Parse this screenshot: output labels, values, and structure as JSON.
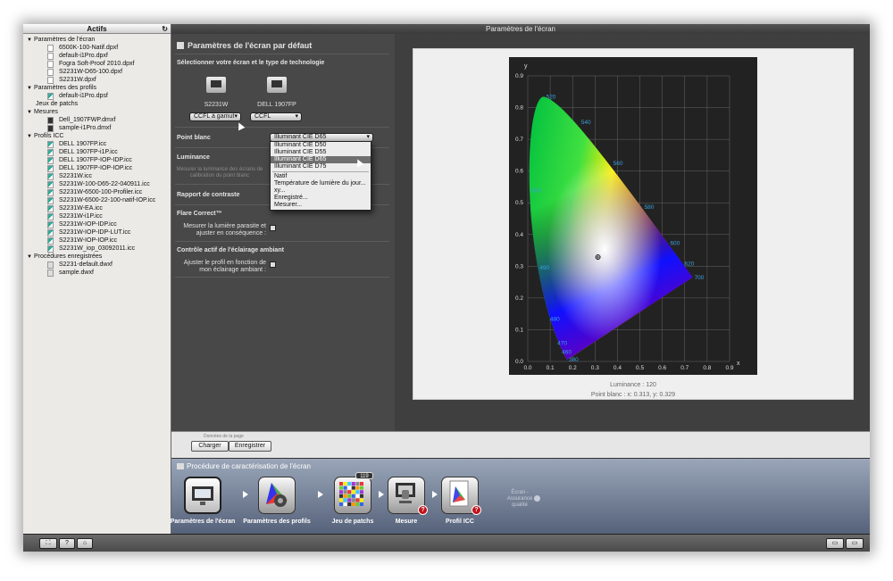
{
  "window_title": "Paramètres de l'écran",
  "sidebar": {
    "header": "Actifs",
    "refresh_icon": "refresh-icon",
    "tree": [
      {
        "type": "cat",
        "label": "Paramètres de l'écran"
      },
      {
        "type": "item",
        "label": "6500K-100-Natif.dpxf",
        "icon": "doc"
      },
      {
        "type": "item",
        "label": "default-i1Pro.dpxf",
        "icon": "doc"
      },
      {
        "type": "item",
        "label": "Fogra Soft-Proof 2010.dpxf",
        "icon": "doc"
      },
      {
        "type": "item",
        "label": "S2231W-D65-100.dpxf",
        "icon": "doc"
      },
      {
        "type": "item",
        "label": "S2231W.dpxf",
        "icon": "doc"
      },
      {
        "type": "cat",
        "label": "Paramètres des profils"
      },
      {
        "type": "item",
        "label": "default-i1Pro.dpsf",
        "icon": "icc"
      },
      {
        "type": "plain",
        "label": "Jeux de patchs"
      },
      {
        "type": "cat",
        "label": "Mesures"
      },
      {
        "type": "item",
        "label": "Dell_1907FWP.dmxf",
        "icon": "dm"
      },
      {
        "type": "item",
        "label": "sample-i1Pro.dmxf",
        "icon": "dm"
      },
      {
        "type": "cat",
        "label": "Profils ICC"
      },
      {
        "type": "item",
        "label": "DELL 1907FP.icc",
        "icon": "icc"
      },
      {
        "type": "item",
        "label": "DELL 1907FP-i1P.icc",
        "icon": "icc"
      },
      {
        "type": "item",
        "label": "DELL 1907FP-IOP-IDP.icc",
        "icon": "icc"
      },
      {
        "type": "item",
        "label": "DELL 1907FP-IOP-IOP.icc",
        "icon": "icc"
      },
      {
        "type": "item",
        "label": "S2231W.icc",
        "icon": "icc"
      },
      {
        "type": "item",
        "label": "S2231W-100-D65-22-040911.icc",
        "icon": "icc"
      },
      {
        "type": "item",
        "label": "S2231W-6500-100-Profiler.icc",
        "icon": "icc"
      },
      {
        "type": "item",
        "label": "S2231W-6500-22-100-natif-IOP.icc",
        "icon": "icc"
      },
      {
        "type": "item",
        "label": "S2231W-EA.icc",
        "icon": "icc"
      },
      {
        "type": "item",
        "label": "S2231W-i1P.icc",
        "icon": "icc"
      },
      {
        "type": "item",
        "label": "S2231W-IOP-IDP.icc",
        "icon": "icc"
      },
      {
        "type": "item",
        "label": "S2231W-IOP-IDP-LUT.icc",
        "icon": "icc"
      },
      {
        "type": "item",
        "label": "S2231W-IOP-IOP.icc",
        "icon": "icc"
      },
      {
        "type": "item",
        "label": "S2231W_iop_03092011.icc",
        "icon": "icc"
      },
      {
        "type": "cat",
        "label": "Procédures enregistrées"
      },
      {
        "type": "item",
        "label": "S2231-default.dwxf",
        "icon": "dw"
      },
      {
        "type": "item",
        "label": "sample.dwxf",
        "icon": "dw"
      }
    ]
  },
  "panel": {
    "title": "Paramètres de l'écran par défaut",
    "select_heading": "Sélectionner votre écran et le type de technologie",
    "monitors": [
      {
        "name": "S2231W",
        "tech": "CCFL à gamut"
      },
      {
        "name": "DELL 1907FP",
        "tech": "CCFL"
      }
    ],
    "white_point_label": "Point blanc",
    "white_point_value": "Illuminant CIE D65",
    "luminance_label": "Luminance",
    "luminance_ghost": "Mesurer la luminance des écrans de\ncalibration du point blanc",
    "contrast_label": "Rapport de contraste",
    "flare_label": "Flare Correct™",
    "flare_option": "Mesurer la lumière parasite et\najuster en conséquence :",
    "ambient_label": "Contrôle actif de l'éclairage ambiant",
    "ambient_option": "Ajuster le profil en fonction de\nmon éclairage ambiant :"
  },
  "dropdown": {
    "options": [
      {
        "label": "Illuminant CIE D50",
        "selected": false
      },
      {
        "label": "Illuminant CIE D55",
        "selected": false
      },
      {
        "label": "Illuminant CIE D65",
        "selected": true
      },
      {
        "label": "Illuminant CIE D75",
        "selected": false
      },
      {
        "sep": true
      },
      {
        "label": "Natif",
        "selected": false
      },
      {
        "label": "Température de lumière du jour...",
        "selected": false
      },
      {
        "label": "xy...",
        "selected": false
      },
      {
        "label": "Enregistré...",
        "selected": false
      },
      {
        "label": "Mesurer...",
        "selected": false
      }
    ]
  },
  "chart_data": {
    "type": "scatter",
    "title": "",
    "xlabel": "x",
    "ylabel": "y",
    "xlim": [
      0,
      0.9
    ],
    "ylim": [
      0,
      0.9
    ],
    "xticks": [
      "0.0",
      "0.1",
      "0.2",
      "0.3",
      "0.4",
      "0.5",
      "0.6",
      "0.7",
      "0.8",
      "0.9"
    ],
    "yticks": [
      "0.0",
      "0.1",
      "0.2",
      "0.3",
      "0.4",
      "0.5",
      "0.6",
      "0.7",
      "0.8",
      "0.9"
    ],
    "grid": true,
    "locus_wavelength_labels": [
      {
        "label": "380",
        "x": 0.175,
        "y": 0.005
      },
      {
        "label": "460",
        "x": 0.144,
        "y": 0.03
      },
      {
        "label": "470",
        "x": 0.124,
        "y": 0.058
      },
      {
        "label": "480",
        "x": 0.091,
        "y": 0.133
      },
      {
        "label": "490",
        "x": 0.045,
        "y": 0.295
      },
      {
        "label": "500",
        "x": 0.008,
        "y": 0.538
      },
      {
        "label": "520",
        "x": 0.074,
        "y": 0.834
      },
      {
        "label": "540",
        "x": 0.23,
        "y": 0.754
      },
      {
        "label": "560",
        "x": 0.373,
        "y": 0.624
      },
      {
        "label": "580",
        "x": 0.512,
        "y": 0.487
      },
      {
        "label": "600",
        "x": 0.627,
        "y": 0.372
      },
      {
        "label": "620",
        "x": 0.691,
        "y": 0.308
      },
      {
        "label": "700",
        "x": 0.735,
        "y": 0.265
      }
    ],
    "white_point": {
      "x": 0.313,
      "y": 0.329
    },
    "luminance_caption": "Luminance : 120",
    "white_point_caption": "Point blanc : x: 0.313, y: 0.329"
  },
  "btnbar": {
    "caption": "Données de la page",
    "load": "Charger",
    "save": "Enregistrer"
  },
  "workflow": {
    "title": "Procédure de caractérisation de l'écran",
    "steps": [
      {
        "label": "Paramètres de l'écran",
        "badge": ""
      },
      {
        "label": "Paramètres des profils",
        "badge": ""
      },
      {
        "label": "Jeu de patchs",
        "badge": "",
        "count": "119"
      },
      {
        "label": "Mesure",
        "badge": "?"
      },
      {
        "label": "Profil ICC",
        "badge": "?"
      }
    ],
    "faded": "Écran -\nAssurance\nqualité"
  },
  "statusbar": {
    "help": "?"
  },
  "colors": {
    "window_bg": "#3f3f3f",
    "panel_bg": "#484848",
    "sidebar_bg": "#eceae6",
    "workflow_top": "#9aa6b8",
    "badge_red": "#c1121b",
    "wavelength_label": "#3aa0e0"
  }
}
